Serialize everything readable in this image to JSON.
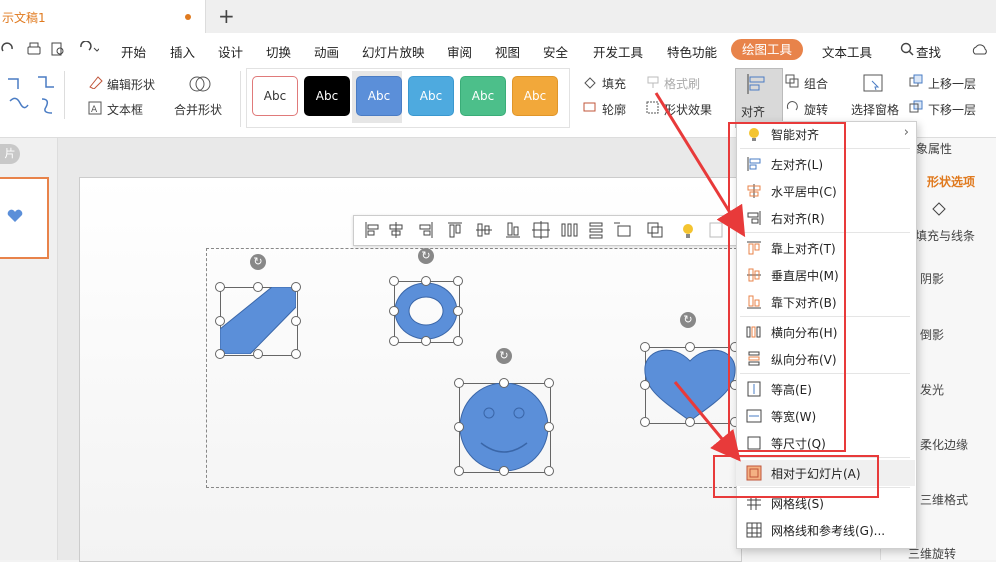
{
  "window": {
    "doc_tab": "示文稿1",
    "new_tab": "+"
  },
  "menu": {
    "items": [
      "开始",
      "插入",
      "设计",
      "切换",
      "动画",
      "幻灯片放映",
      "审阅",
      "视图",
      "安全",
      "开发工具",
      "特色功能"
    ],
    "active": "绘图工具",
    "text_tool": "文本工具",
    "find": "查找"
  },
  "ribbon": {
    "edit_shape": "编辑形状",
    "text_box": "文本框",
    "merge_shape": "合并形状",
    "styles": [
      {
        "label": "Abc",
        "bg": "#ffffff",
        "fg": "#333333",
        "border": "#e07a7a"
      },
      {
        "label": "Abc",
        "bg": "#000000",
        "fg": "#ffffff",
        "border": "#000000"
      },
      {
        "label": "Abc",
        "bg": "#5b8fd9",
        "fg": "#ffffff",
        "border": "#4a7cc4"
      },
      {
        "label": "Abc",
        "bg": "#4eaadf",
        "fg": "#ffffff",
        "border": "#3a98cf"
      },
      {
        "label": "Abc",
        "bg": "#4cbf8a",
        "fg": "#ffffff",
        "border": "#3aad78"
      },
      {
        "label": "Abc",
        "bg": "#f2a83a",
        "fg": "#ffffff",
        "border": "#e0962a"
      }
    ],
    "fill": "填充",
    "format_painter": "格式刷",
    "outline": "轮廓",
    "shape_effects": "形状效果",
    "align": "对齐",
    "group": "组合",
    "rotate": "旋转",
    "selection_pane": "选择窗格",
    "bring_forward": "上移一层",
    "send_backward": "下移一层"
  },
  "left_pane": {
    "label": "片"
  },
  "right_pane": {
    "title": "象属性",
    "tab": "形状选项",
    "fill_line": "填充与线条",
    "items": [
      "阴影",
      "倒影",
      "发光",
      "柔化边缘",
      "三维格式",
      "三维旋转"
    ]
  },
  "align_menu": {
    "items": [
      {
        "label": "智能对齐",
        "icon": "bulb-icon",
        "has_sub": true
      },
      {
        "label": "左对齐(L)",
        "icon": "align-left-icon"
      },
      {
        "label": "水平居中(C)",
        "icon": "align-center-h-icon"
      },
      {
        "label": "右对齐(R)",
        "icon": "align-right-icon"
      },
      {
        "label": "靠上对齐(T)",
        "icon": "align-top-icon"
      },
      {
        "label": "垂直居中(M)",
        "icon": "align-middle-v-icon"
      },
      {
        "label": "靠下对齐(B)",
        "icon": "align-bottom-icon"
      },
      {
        "label": "横向分布(H)",
        "icon": "distribute-h-icon"
      },
      {
        "label": "纵向分布(V)",
        "icon": "distribute-v-icon"
      },
      {
        "label": "等高(E)",
        "icon": "same-height-icon"
      },
      {
        "label": "等宽(W)",
        "icon": "same-width-icon"
      },
      {
        "label": "等尺寸(Q)",
        "icon": "same-size-icon"
      },
      {
        "label": "相对于幻灯片(A)",
        "icon": "relative-slide-icon",
        "highlight": true
      },
      {
        "label": "网格线(S)",
        "icon": "grid-icon"
      },
      {
        "label": "网格线和参考线(G)...",
        "icon": "grid-guides-icon"
      }
    ]
  },
  "colors": {
    "accent": "#e8834a",
    "shape_fill": "#5b8fd9",
    "annotation_red": "#e83a3a"
  }
}
